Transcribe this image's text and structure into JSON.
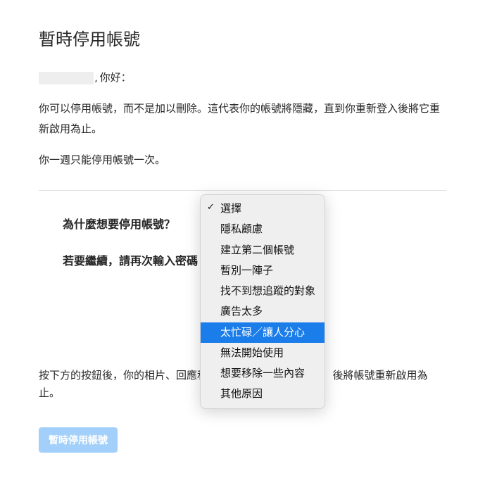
{
  "page_title": "暫時停用帳號",
  "greeting_suffix": ", 你好：",
  "body_para_1": "你可以停用帳號，而不是加以刪除。這代表你的帳號將隱藏，直到你重新登入後將它重新啟用為止。",
  "body_para_2": "你一週只能停用帳號一次。",
  "form": {
    "reason_label": "為什麼想要停用帳號？",
    "password_label": "若要繼續，請再次輸入密碼"
  },
  "below_prefix": "按下方的按鈕後，你的相片、回應和",
  "below_suffix": "後將帳號重新啟用為止。",
  "disable_button_label": "暫時停用帳號",
  "dropdown": {
    "selected_index": 0,
    "highlight_index": 6,
    "items": [
      "選擇",
      "隱私顧慮",
      "建立第二個帳號",
      "暫別一陣子",
      "找不到想追蹤的對象",
      "廣告太多",
      "太忙碌／讓人分心",
      "無法開始使用",
      "想要移除一些內容",
      "其他原因"
    ]
  }
}
